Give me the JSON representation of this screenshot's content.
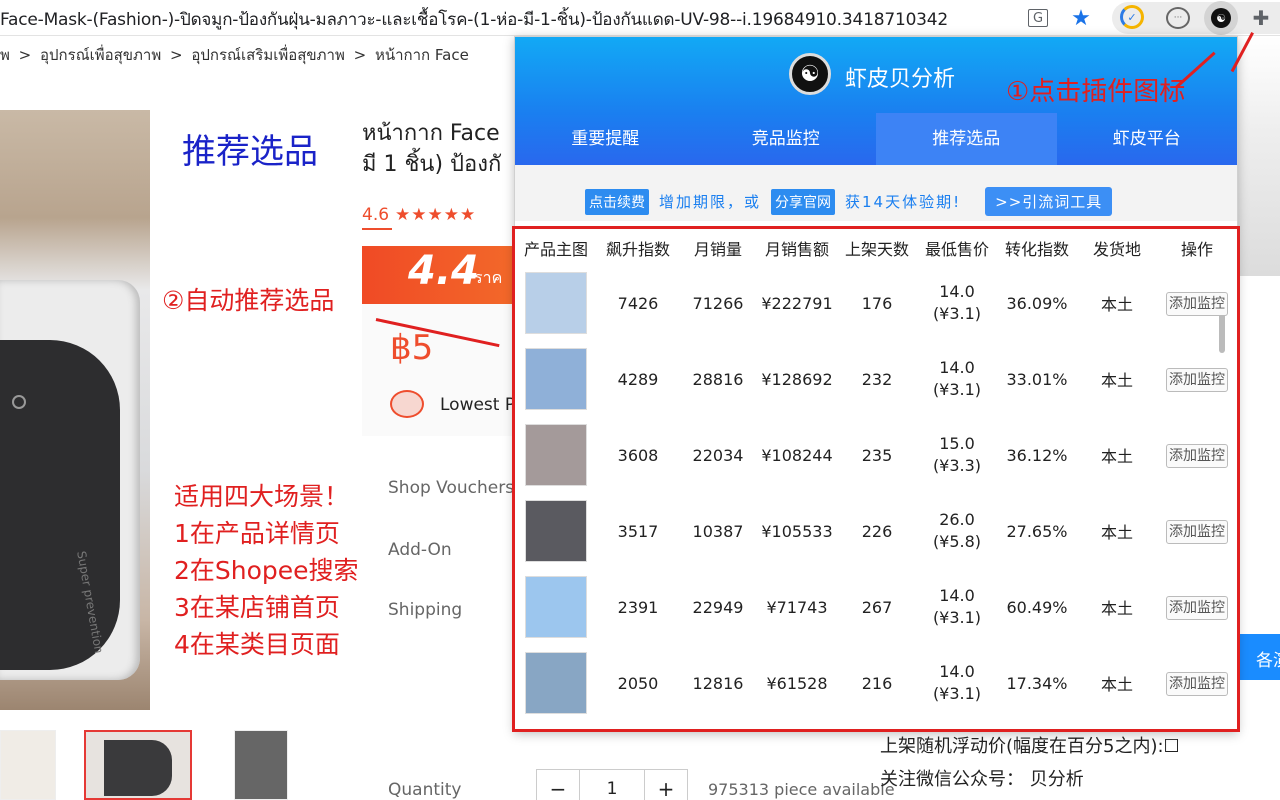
{
  "browser": {
    "url": "Face-Mask-(Fashion-)-ปิดจมูก-ป้องกันฝุ่น-มลภาวะ-และเชื้อโรค-(1-ห่อ-มี-1-ชิ้น)-ป้องกันแดด-UV-98--i.19684910.3418710342",
    "icons": [
      "translate-icon",
      "star-icon",
      "check-extension-icon",
      "message-extension-icon",
      "xiapibei-extension-icon",
      "puzzle-icon"
    ]
  },
  "breadcrumb": [
    "พ",
    ">",
    "อุปกรณ์เพื่อสุขภาพ",
    ">",
    "อุปกรณ์เสริมเพื่อสุขภาพ",
    ">",
    "หน้ากาก Face"
  ],
  "product": {
    "title_line1": "หน้ากาก Face",
    "title_line2": "มี 1 ชิ้น) ป้องกั",
    "rating": "4.6",
    "stars": "★★★★★",
    "flash_num": "4.4",
    "flash_sub": "ราค",
    "price": "฿5",
    "lowest": "Lowest P",
    "labels": {
      "vouchers": "Shop Vouchers",
      "addon": "Add-On",
      "shipping": "Shipping",
      "quantity": "Quantity"
    },
    "qty_minus": "−",
    "qty_value": "1",
    "qty_plus": "+",
    "available": "975313 piece available",
    "bag_text": "Super prevention"
  },
  "annotations": {
    "rec_title": "推荐选品",
    "auto_rec": "②自动推荐选品",
    "click_icon": "①点击插件图标",
    "scenes": [
      "适用四大场景！",
      "1在产品详情页",
      "2在Shopee搜索",
      "3在某店铺首页",
      "4在某类目页面"
    ]
  },
  "right_notes": {
    "float_price": "上架随机浮动价(幅度在百分5之内):☐",
    "wechat": "关注微信公众号： 贝分析",
    "blue_btn": "各演"
  },
  "popup": {
    "logo_glyph": "☯",
    "title": "虾皮贝分析",
    "tabs": [
      "重要提醒",
      "竞品监控",
      "推荐选品",
      "虾皮平台"
    ],
    "active_tab": 2,
    "ad": {
      "renew_btn": "点击续费",
      "text1": "增加期限，或",
      "share_btn": "分享官网",
      "text2": "获14天体验期!",
      "tool_btn": ">>引流词工具"
    },
    "columns": [
      "产品主图",
      "飙升指数",
      "月销量",
      "月销售额",
      "上架天数",
      "最低售价",
      "转化指数",
      "发货地",
      "操作"
    ],
    "rows": [
      {
        "img_color": "#b8cfe8",
        "soar": "7426",
        "sales": "71266",
        "revenue": "¥222791",
        "days": "176",
        "price": "14.0",
        "price_cny": "(¥3.1)",
        "conv": "36.09%",
        "origin": "本土",
        "action": "添加监控"
      },
      {
        "img_color": "#8fb0d8",
        "soar": "4289",
        "sales": "28816",
        "revenue": "¥128692",
        "days": "232",
        "price": "14.0",
        "price_cny": "(¥3.1)",
        "conv": "33.01%",
        "origin": "本土",
        "action": "添加监控"
      },
      {
        "img_color": "#a49a9a",
        "soar": "3608",
        "sales": "22034",
        "revenue": "¥108244",
        "days": "235",
        "price": "15.0",
        "price_cny": "(¥3.3)",
        "conv": "36.12%",
        "origin": "本土",
        "action": "添加监控"
      },
      {
        "img_color": "#5a5a60",
        "soar": "3517",
        "sales": "10387",
        "revenue": "¥105533",
        "days": "226",
        "price": "26.0",
        "price_cny": "(¥5.8)",
        "conv": "27.65%",
        "origin": "本土",
        "action": "添加监控"
      },
      {
        "img_color": "#9cc6ee",
        "soar": "2391",
        "sales": "22949",
        "revenue": "¥71743",
        "days": "267",
        "price": "14.0",
        "price_cny": "(¥3.1)",
        "conv": "60.49%",
        "origin": "本土",
        "action": "添加监控"
      },
      {
        "img_color": "#88a6c4",
        "soar": "2050",
        "sales": "12816",
        "revenue": "¥61528",
        "days": "216",
        "price": "14.0",
        "price_cny": "(¥3.1)",
        "conv": "17.34%",
        "origin": "本土",
        "action": "添加监控"
      }
    ]
  },
  "colors": {
    "accent": "#1a7ff0",
    "annotation_red": "#e02020",
    "shopee_orange": "#ee4d2d"
  }
}
